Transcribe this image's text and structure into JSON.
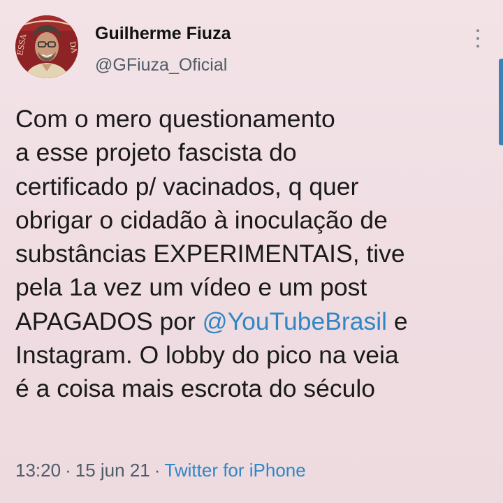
{
  "author": {
    "name": "Guilherme Fiuza",
    "handle": "@GFiuza_Oficial"
  },
  "tweet": {
    "lines": [
      [
        "Com o mero questionamento"
      ],
      [
        "a esse projeto fascista do"
      ],
      [
        "certificado p/ vacinados, q quer"
      ],
      [
        "obrigar o cidadão à inoculação de"
      ],
      [
        "substâncias EXPERIMENTAIS, tive"
      ],
      [
        "pela 1a vez um vídeo e um post"
      ],
      [
        "APAGADOS por ",
        "@YouTubeBrasil",
        " e"
      ],
      [
        "Instagram. O lobby do pico na veia"
      ],
      [
        "é a coisa mais escrota do século"
      ]
    ],
    "mention": "@YouTubeBrasil"
  },
  "meta": {
    "time": "13:20",
    "separator": "·",
    "date": "15 jun 21",
    "source": "Twitter for iPhone"
  },
  "colors": {
    "background": "#f1dfe3",
    "link": "#2f87c5",
    "secondary_text": "#4f5b66",
    "edge_accent": "#3a83b8"
  },
  "icons": {
    "more": "more-vertical-icon"
  }
}
